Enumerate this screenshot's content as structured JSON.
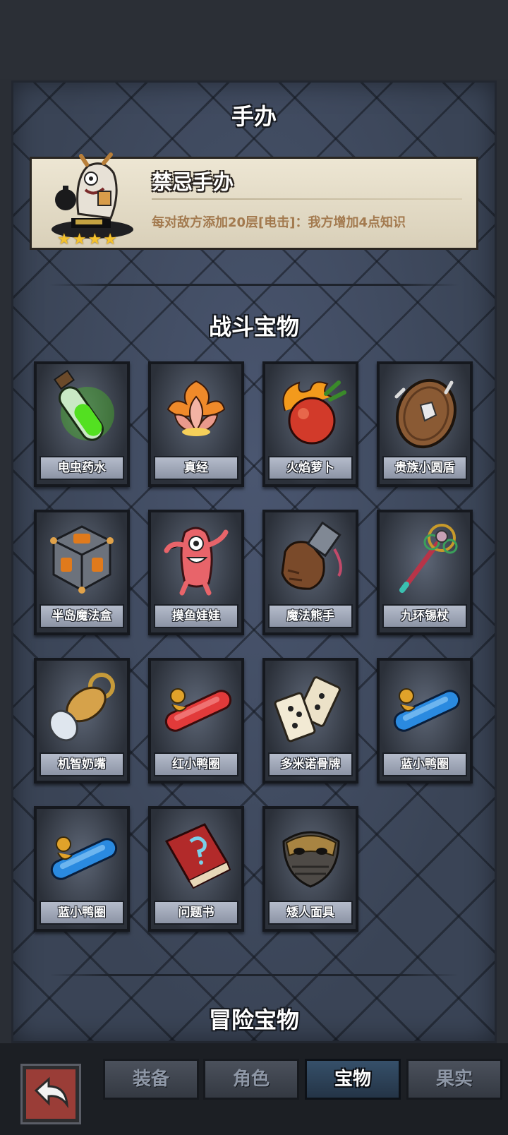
{
  "sections": {
    "figure_title": "手办",
    "battle_title": "战斗宝物",
    "adventure_title": "冒险宝物"
  },
  "figure": {
    "name": "禁忌手办",
    "description": "每对敌方添加20层[电击]：我方增加4点知识",
    "stars": 4,
    "star_glyph": "★"
  },
  "battle_items": [
    {
      "label": "电虫药水",
      "icon": "green-potion-vial-icon"
    },
    {
      "label": "真经",
      "icon": "flaming-lotus-icon"
    },
    {
      "label": "火焰萝卜",
      "icon": "flaming-turnip-icon"
    },
    {
      "label": "贵族小圆盾",
      "icon": "round-shield-icon"
    },
    {
      "label": "半岛魔法盒",
      "icon": "magic-cube-icon"
    },
    {
      "label": "摸鱼娃娃",
      "icon": "pink-doll-icon"
    },
    {
      "label": "魔法熊手",
      "icon": "bear-paw-icon"
    },
    {
      "label": "九环锡杖",
      "icon": "ringed-staff-icon"
    },
    {
      "label": "机智奶嘴",
      "icon": "pacifier-icon"
    },
    {
      "label": "红小鸭圈",
      "icon": "red-duck-ring-icon"
    },
    {
      "label": "多米诺骨牌",
      "icon": "dominoes-icon"
    },
    {
      "label": "蓝小鸭圈",
      "icon": "blue-duck-ring-icon"
    },
    {
      "label": "蓝小鸭圈",
      "icon": "blue-duck-ring-icon"
    },
    {
      "label": "问题书",
      "icon": "question-book-icon"
    },
    {
      "label": "矮人面具",
      "icon": "dwarf-mask-icon"
    }
  ],
  "nav": {
    "tabs": [
      {
        "label": "装备",
        "active": false
      },
      {
        "label": "角色",
        "active": false
      },
      {
        "label": "宝物",
        "active": true
      },
      {
        "label": "果实",
        "active": false
      }
    ],
    "back_icon": "back-arrow-icon"
  }
}
